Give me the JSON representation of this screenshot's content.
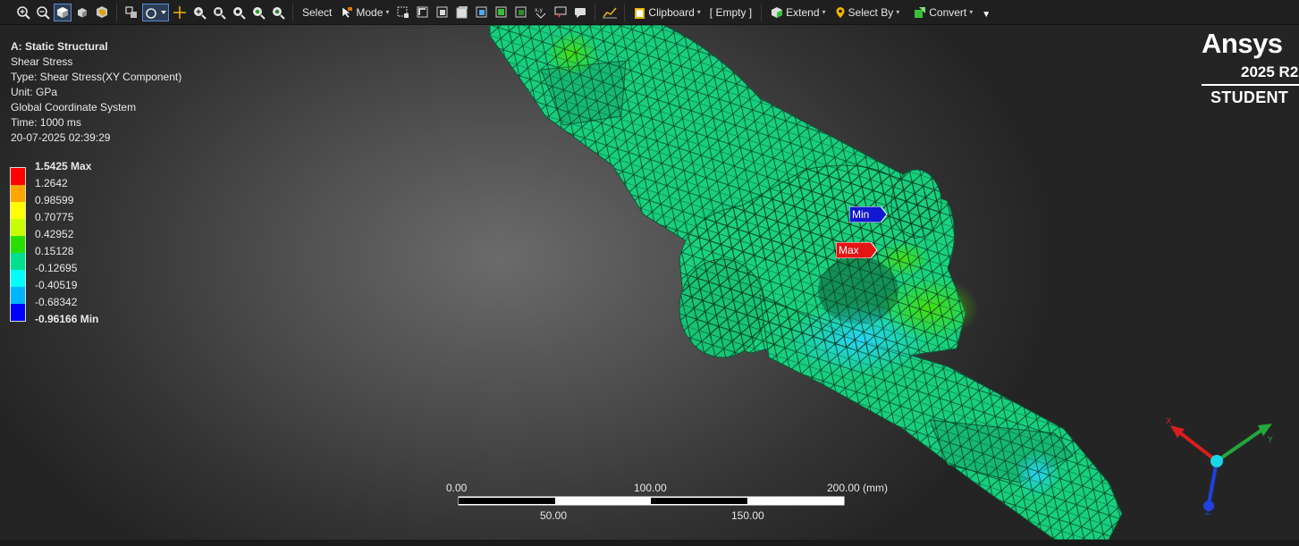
{
  "toolbar": {
    "select_label": "Select",
    "mode_label": "Mode",
    "clipboard_label": "Clipboard",
    "empty_label": "[ Empty ]",
    "extend_label": "Extend",
    "select_by_label": "Select By",
    "convert_label": "Convert"
  },
  "info": {
    "title": "A: Static Structural",
    "result": "Shear Stress",
    "type": "Type: Shear Stress(XY Component)",
    "unit": "Unit: GPa",
    "coord": "Global Coordinate System",
    "time": "Time: 1000 ms",
    "date": "20-07-2025 02:39:29"
  },
  "legend": {
    "labels": [
      "1.5425 Max",
      "1.2642",
      "0.98599",
      "0.70775",
      "0.42952",
      "0.15128",
      "-0.12695",
      "-0.40519",
      "-0.68342",
      "-0.96166 Min"
    ],
    "colors": [
      "#ff0000",
      "#ffa500",
      "#ffff00",
      "#c8ff00",
      "#28e000",
      "#00e090",
      "#00ffff",
      "#00b4ff",
      "#0000ff"
    ]
  },
  "logo": {
    "brand": "Ansys",
    "version": "2025 R2",
    "edition": "STUDENT"
  },
  "probes": {
    "min_label": "Min",
    "max_label": "Max"
  },
  "scale_bar": {
    "top_labels": [
      "0.00",
      "100.00",
      "200.00 (mm)"
    ],
    "bottom_labels": [
      "50.00",
      "150.00"
    ]
  },
  "triad": {
    "x_label": "X",
    "y_label": "Y",
    "z_label": "Z",
    "x_color": "#d81e1e",
    "y_color": "#22a83a",
    "z_color": "#2040e0"
  }
}
